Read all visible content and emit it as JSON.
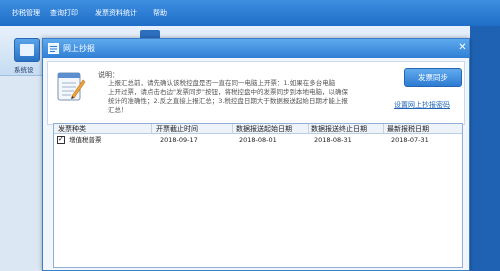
{
  "app": {
    "menu": [
      "抄税管理",
      "查询打印",
      "发票资料统计",
      "帮助"
    ],
    "toolbar_label": "系统设"
  },
  "dialog": {
    "title": "网上抄报",
    "close_icon": "close-icon",
    "note_heading": "说明：",
    "note_lines": [
      "上报汇总前，请先确认该税控盘是否一直在同一电脑上开票：1.如果在多台电脑",
      "上开过票，请点击右边\"发票同步\"按钮，将税控盘中的发票同步到本地电脑，以确保",
      "统计的准确性；2.反之直接上报汇总；3.税控盘日期大于数据报送起始日期才能上报",
      "汇总！"
    ],
    "sync_button": "发票同步",
    "pwd_link": "设置网上抄报密码",
    "table": {
      "headers": [
        "发票种类",
        "开票截止时间",
        "数据报送起始日期",
        "数据报送终止日期",
        "最新报税日期"
      ],
      "rows": [
        {
          "checked": true,
          "type": "增值税普票",
          "deadline": "2018-09-17",
          "start": "2018-08-01",
          "end": "2018-08-31",
          "latest": "2018-07-31"
        }
      ]
    }
  }
}
